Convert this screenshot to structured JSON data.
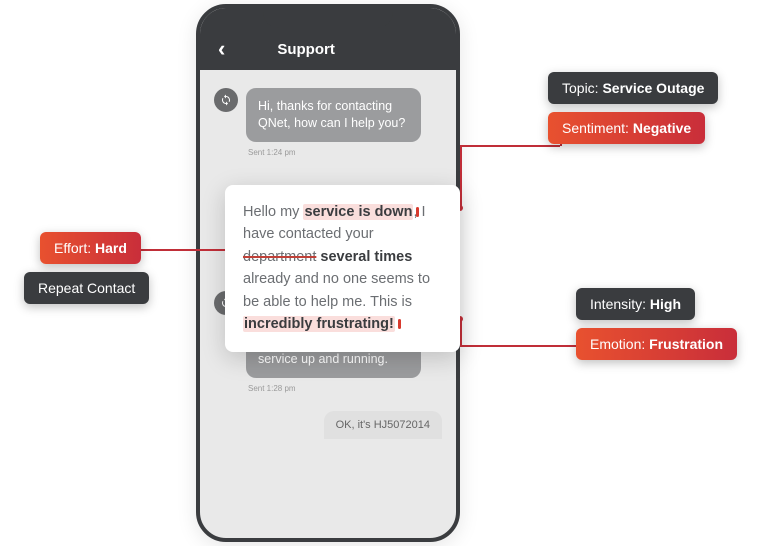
{
  "phone": {
    "header_title": "Support",
    "messages": {
      "agent1": "Hi, thanks for contacting QNet, how can I help you?",
      "agent1_ts": "Sent 1:24 pm",
      "agent2": "Oh I'm sorry! Let me get your account number so I can help you get your service up and running.",
      "agent2_ts": "Sent 1:28 pm",
      "user_partial": "OK, it's HJ5072014"
    }
  },
  "highlight": {
    "p1a": "Hello my ",
    "p1b": "service is down",
    "p1c": ", I have contacted your ",
    "p1d": "department",
    "p1e": " ",
    "p1f": "several times",
    "p1g": " already and no one seems to be able to help me. This is ",
    "p1h": "incredibly frustrating!"
  },
  "tags": {
    "topic_label": "Topic: ",
    "topic_value": "Service Outage",
    "sentiment_label": "Sentiment: ",
    "sentiment_value": "Negative",
    "intensity_label": "Intensity: ",
    "intensity_value": "High",
    "emotion_label": "Emotion: ",
    "emotion_value": "Frustration",
    "effort_label": "Effort: ",
    "effort_value": "Hard",
    "repeat": "Repeat Contact"
  }
}
